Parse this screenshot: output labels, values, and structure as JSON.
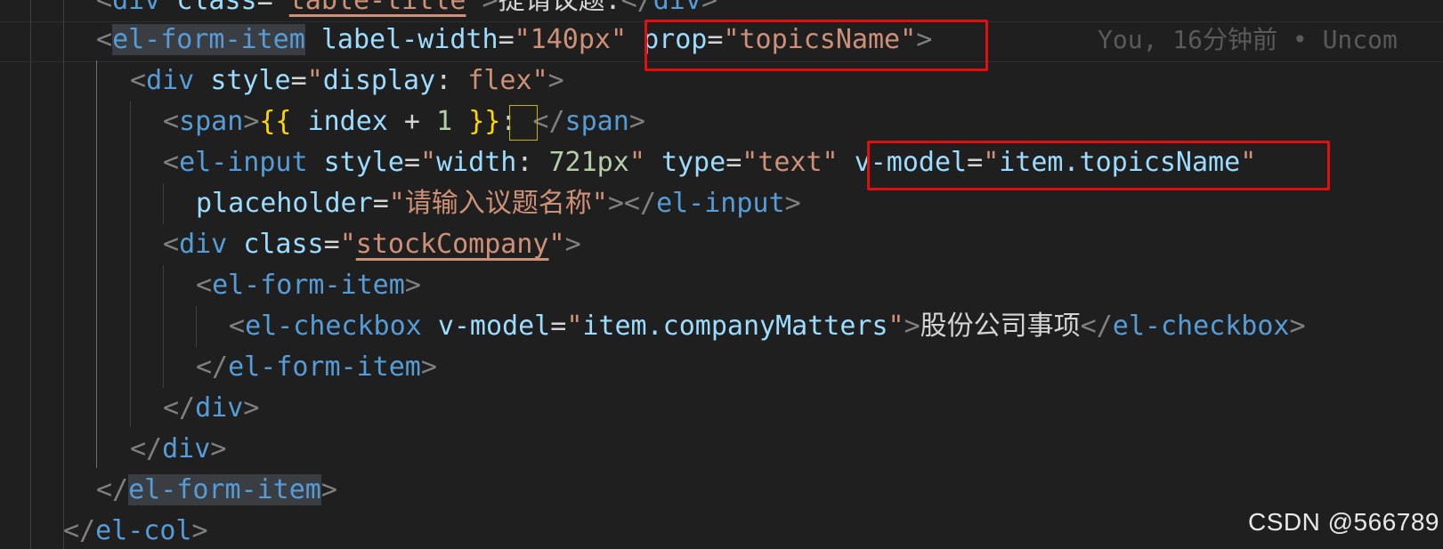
{
  "editor": {
    "lines": [
      {
        "segments": [
          [
            "t",
            "<"
          ],
          [
            "tag",
            "div"
          ],
          [
            "txt",
            " "
          ],
          [
            "attr",
            "class"
          ],
          [
            "txt",
            "="
          ],
          [
            "val",
            "\""
          ],
          [
            "val",
            "table-title"
          ],
          [
            "val",
            "\""
          ],
          [
            "t",
            ">"
          ],
          [
            "txt",
            "提请议题:"
          ],
          [
            "t",
            "</"
          ],
          [
            "tag",
            "div"
          ],
          [
            "t",
            ">"
          ]
        ]
      },
      {
        "segments": [
          [
            "t",
            "<"
          ],
          [
            "tag",
            "el-form-item"
          ],
          [
            "txt",
            " "
          ],
          [
            "attr",
            "label-width"
          ],
          [
            "txt",
            "="
          ],
          [
            "val",
            "\"140px\""
          ],
          [
            "txt",
            " "
          ],
          [
            "attr",
            "prop"
          ],
          [
            "txt",
            "="
          ],
          [
            "val",
            "\"topicsName\""
          ],
          [
            "t",
            ">"
          ]
        ]
      },
      {
        "segments": [
          [
            "t",
            "<"
          ],
          [
            "tag",
            "div"
          ],
          [
            "txt",
            " "
          ],
          [
            "attr",
            "style"
          ],
          [
            "txt",
            "="
          ],
          [
            "val",
            "\""
          ],
          [
            "attr",
            "display"
          ],
          [
            "txt",
            ": "
          ],
          [
            "val",
            "flex"
          ],
          [
            "val",
            "\""
          ],
          [
            "t",
            ">"
          ]
        ]
      },
      {
        "segments": [
          [
            "t",
            "<"
          ],
          [
            "tag",
            "span"
          ],
          [
            "t",
            ">"
          ],
          [
            "brace",
            "{{"
          ],
          [
            "txt",
            " "
          ],
          [
            "attr",
            "index"
          ],
          [
            "txt",
            " + "
          ],
          [
            "num",
            "1"
          ],
          [
            "txt",
            " "
          ],
          [
            "brace",
            "}}"
          ],
          [
            "txt",
            ":"
          ],
          [
            "t",
            " </"
          ],
          [
            "tag",
            "span"
          ],
          [
            "t",
            ">"
          ]
        ]
      },
      {
        "segments": [
          [
            "t",
            "<"
          ],
          [
            "tag",
            "el-input"
          ],
          [
            "txt",
            " "
          ],
          [
            "attr",
            "style"
          ],
          [
            "txt",
            "="
          ],
          [
            "val",
            "\""
          ],
          [
            "attr",
            "width"
          ],
          [
            "txt",
            ": "
          ],
          [
            "num",
            "721px"
          ],
          [
            "val",
            "\""
          ],
          [
            "txt",
            " "
          ],
          [
            "attr",
            "type"
          ],
          [
            "txt",
            "="
          ],
          [
            "val",
            "\"text\""
          ],
          [
            "txt",
            " "
          ],
          [
            "attr",
            "v-model"
          ],
          [
            "txt",
            "="
          ],
          [
            "val",
            "\""
          ],
          [
            "attr",
            "item.topicsName"
          ],
          [
            "val",
            "\""
          ]
        ]
      },
      {
        "segments": [
          [
            "attr",
            "placeholder"
          ],
          [
            "txt",
            "="
          ],
          [
            "val",
            "\"请输入议题名称\""
          ],
          [
            "t",
            "></"
          ],
          [
            "tag",
            "el-input"
          ],
          [
            "t",
            ">"
          ]
        ]
      },
      {
        "segments": [
          [
            "t",
            "<"
          ],
          [
            "tag",
            "div"
          ],
          [
            "txt",
            " "
          ],
          [
            "attr",
            "class"
          ],
          [
            "txt",
            "="
          ],
          [
            "val",
            "\""
          ],
          [
            "val",
            "stockCompany"
          ],
          [
            "val",
            "\""
          ],
          [
            "t",
            ">"
          ]
        ]
      },
      {
        "segments": [
          [
            "t",
            "<"
          ],
          [
            "tag",
            "el-form-item"
          ],
          [
            "t",
            ">"
          ]
        ]
      },
      {
        "segments": [
          [
            "t",
            "<"
          ],
          [
            "tag",
            "el-checkbox"
          ],
          [
            "txt",
            " "
          ],
          [
            "attr",
            "v-model"
          ],
          [
            "txt",
            "="
          ],
          [
            "val",
            "\""
          ],
          [
            "attr",
            "item.companyMatters"
          ],
          [
            "val",
            "\""
          ],
          [
            "t",
            ">"
          ],
          [
            "txt",
            "股份公司事项"
          ],
          [
            "t",
            "</"
          ],
          [
            "tag",
            "el-checkbox"
          ],
          [
            "t",
            ">"
          ]
        ]
      },
      {
        "segments": [
          [
            "t",
            "</"
          ],
          [
            "tag",
            "el-form-item"
          ],
          [
            "t",
            ">"
          ]
        ]
      },
      {
        "segments": [
          [
            "t",
            "</"
          ],
          [
            "tag",
            "div"
          ],
          [
            "t",
            ">"
          ]
        ]
      },
      {
        "segments": [
          [
            "t",
            "</"
          ],
          [
            "tag",
            "div"
          ],
          [
            "t",
            ">"
          ]
        ]
      },
      {
        "segments": [
          [
            "t",
            "</"
          ],
          [
            "tag",
            "el-form-item"
          ],
          [
            "t",
            ">"
          ]
        ]
      },
      {
        "segments": [
          [
            "t",
            "</"
          ],
          [
            "tag",
            "el-col"
          ],
          [
            "t",
            ">"
          ]
        ]
      }
    ],
    "blame": "You, 16分钟前 • Uncom"
  },
  "watermark": "CSDN @566789"
}
